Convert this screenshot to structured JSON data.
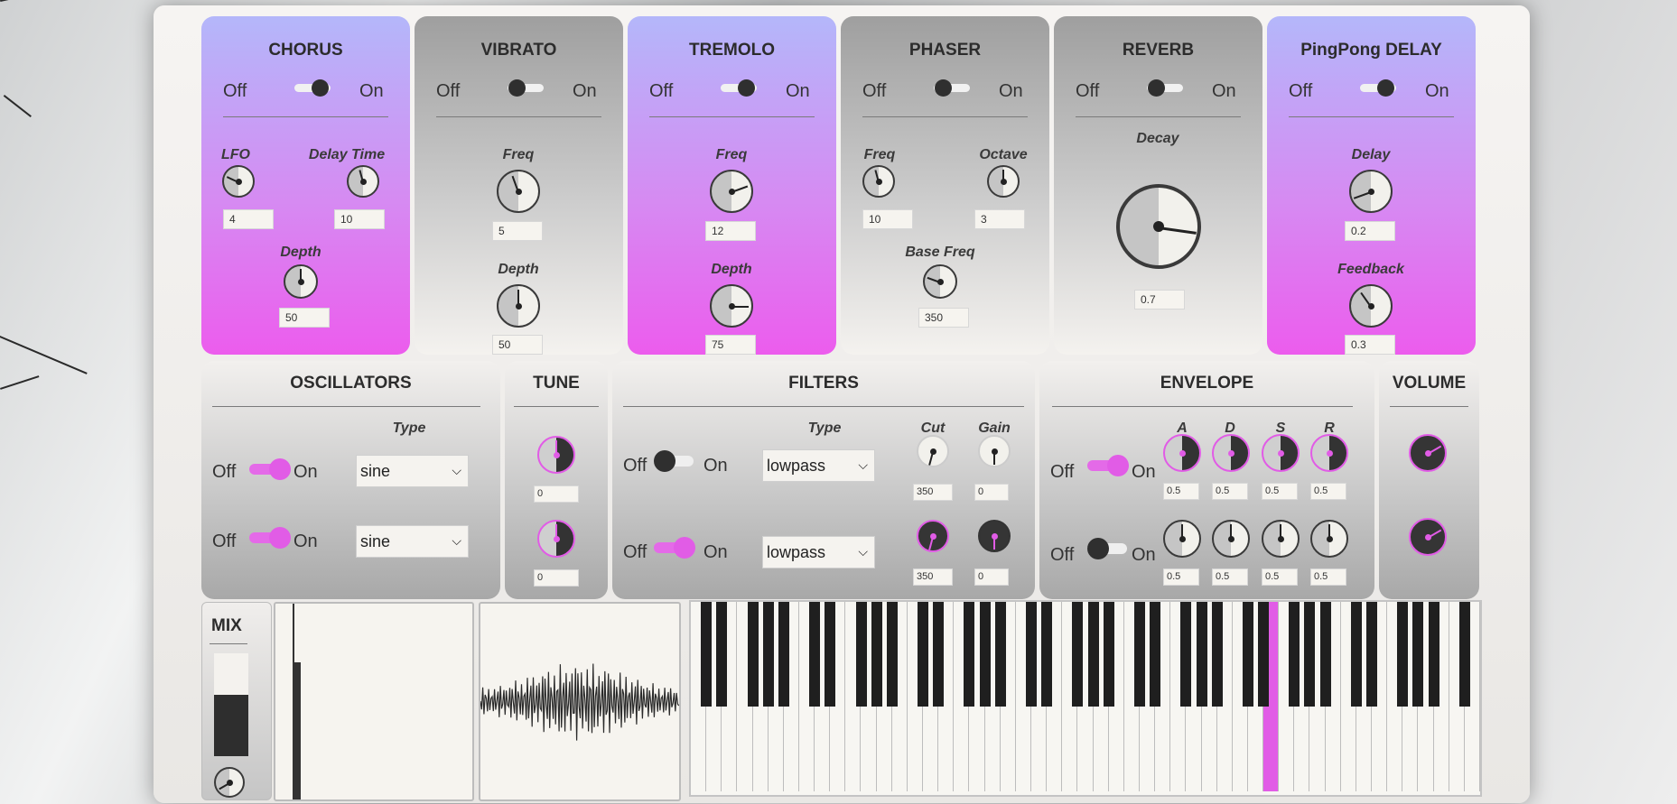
{
  "effects": [
    {
      "title": "CHORUS",
      "off": "Off",
      "on": "On",
      "state": "on",
      "controls": [
        {
          "label": "LFO",
          "value": "4"
        },
        {
          "label": "Delay Time",
          "value": "10"
        },
        {
          "label": "Depth",
          "value": "50"
        }
      ]
    },
    {
      "title": "VIBRATO",
      "off": "Off",
      "on": "On",
      "state": "off",
      "controls": [
        {
          "label": "Freq",
          "value": "5"
        },
        {
          "label": "Depth",
          "value": "50"
        }
      ]
    },
    {
      "title": "TREMOLO",
      "off": "Off",
      "on": "On",
      "state": "on",
      "controls": [
        {
          "label": "Freq",
          "value": "12"
        },
        {
          "label": "Depth",
          "value": "75"
        }
      ]
    },
    {
      "title": "PHASER",
      "off": "Off",
      "on": "On",
      "state": "off",
      "controls": [
        {
          "label": "Freq",
          "value": "10"
        },
        {
          "label": "Octave",
          "value": "3"
        },
        {
          "label": "Base Freq",
          "value": "350"
        }
      ]
    },
    {
      "title": "REVERB",
      "off": "Off",
      "on": "On",
      "state": "off",
      "controls": [
        {
          "label": "Decay",
          "value": "0.7"
        }
      ]
    },
    {
      "title": "PingPong DELAY",
      "off": "Off",
      "on": "On",
      "state": "on",
      "controls": [
        {
          "label": "Delay",
          "value": "0.2"
        },
        {
          "label": "Feedback",
          "value": "0.3"
        }
      ]
    }
  ],
  "oscillators": {
    "title": "OSCILLATORS",
    "type_label": "Type",
    "off": "Off",
    "on": "On",
    "rows": [
      {
        "state": "on",
        "type": "sine"
      },
      {
        "state": "on",
        "type": "sine"
      }
    ]
  },
  "tune": {
    "title": "TUNE",
    "values": [
      "0",
      "0"
    ]
  },
  "filters": {
    "title": "FILTERS",
    "type_label": "Type",
    "cut_label": "Cut",
    "gain_label": "Gain",
    "off": "Off",
    "on": "On",
    "rows": [
      {
        "state": "off",
        "type": "lowpass",
        "cut": "350",
        "gain": "0"
      },
      {
        "state": "on",
        "type": "lowpass",
        "cut": "350",
        "gain": "0"
      }
    ]
  },
  "envelope": {
    "title": "ENVELOPE",
    "off": "Off",
    "on": "On",
    "labels": [
      "A",
      "D",
      "S",
      "R"
    ],
    "rows": [
      {
        "state": "on",
        "values": [
          "0.5",
          "0.5",
          "0.5",
          "0.5"
        ]
      },
      {
        "state": "off",
        "values": [
          "0.5",
          "0.5",
          "0.5",
          "0.5"
        ]
      }
    ]
  },
  "volume": {
    "title": "VOLUME"
  },
  "mix": {
    "title": "MIX",
    "level": 0.6
  },
  "keyboard": {
    "active_key": "highlighted"
  },
  "colors": {
    "accent": "#e15ce6",
    "panel_purple_top": "#b4b7fa",
    "panel_purple_bottom": "#ec5ced"
  }
}
